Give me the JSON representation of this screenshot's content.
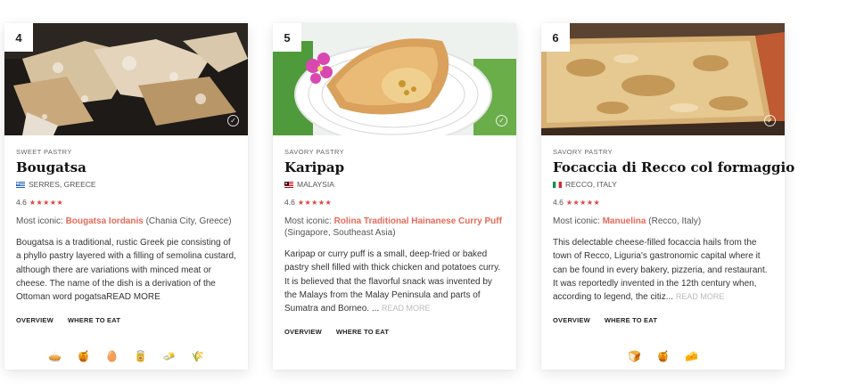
{
  "cards": [
    {
      "rank": "4",
      "category": "SWEET PASTRY",
      "title": "Bougatsa",
      "origin": "SERRES, GREECE",
      "rating": "4.6",
      "stars": "★★★★★",
      "iconic_label": "Most iconic: ",
      "iconic_place": "Bougatsa Iordanis",
      "iconic_location": " (Chania City, Greece)",
      "description": "Bougatsa is a traditional, rustic Greek pie consisting of a phyllo pastry layered with a filling of semolina custard, although there are variations with minced meat or cheese. The name of the dish is a derivation of the Ottoman word pogatsa",
      "read_more": "READ MORE",
      "tab_overview": "OVERVIEW",
      "tab_where": "WHERE TO EAT",
      "extras": [
        "🥧",
        "🍯",
        "🥚",
        "🥫",
        "🧈",
        "🌾"
      ]
    },
    {
      "rank": "5",
      "category": "SAVORY PASTRY",
      "title": "Karipap",
      "origin": "MALAYSIA",
      "rating": "4.6",
      "stars": "★★★★★",
      "iconic_label": "Most iconic: ",
      "iconic_place": "Rolina Traditional Hainanese Curry Puff",
      "iconic_location": " (Singapore, Southeast Asia)",
      "description": "Karipap or curry puff is a small, deep-fried or baked pastry shell filled with thick chicken and potatoes curry. It is believed that the flavorful snack was invented by the Malays from the Malay Peninsula and parts of Sumatra and Borneo. ...",
      "read_more": "READ MORE",
      "tab_overview": "OVERVIEW",
      "tab_where": "WHERE TO EAT"
    },
    {
      "rank": "6",
      "category": "SAVORY PASTRY",
      "title": "Focaccia di Recco col formaggio",
      "origin": "RECCO, ITALY",
      "rating": "4.6",
      "stars": "★★★★★",
      "iconic_label": "Most iconic: ",
      "iconic_place": "Manuelina",
      "iconic_location": " (Recco, Italy)",
      "description": "This delectable cheese-filled focaccia hails from the town of Recco, Liguria's gastronomic capital where it can be found in every bakery, pizzeria, and restaurant. It was reportedly invented in the 12th century when, according to legend, the citiz...",
      "read_more": "READ MORE",
      "tab_overview": "OVERVIEW",
      "tab_where": "WHERE TO EAT",
      "extras": [
        "🍞",
        "🍯",
        "🧀"
      ]
    }
  ],
  "colors": {
    "accent": "#e56a59",
    "stars": "#e3413c"
  }
}
